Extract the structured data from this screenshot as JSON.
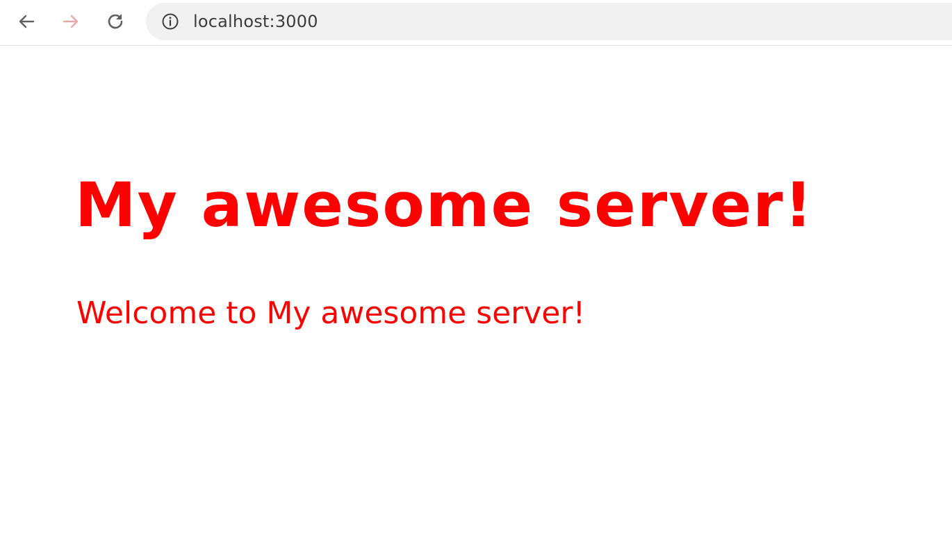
{
  "browser": {
    "address_bar": {
      "url": "localhost:3000"
    },
    "icons": {
      "back": "arrow-left-icon",
      "forward": "arrow-right-icon",
      "reload": "reload-icon",
      "site_info": "info-icon"
    }
  },
  "page": {
    "heading": "My awesome server!",
    "welcome_text": "Welcome to My awesome server!"
  },
  "colors": {
    "text": "#ff0000",
    "omnibox_bg": "#f1f1f1",
    "forward_icon": "#e8a7a7",
    "nav_icon": "#5f5f5f"
  }
}
